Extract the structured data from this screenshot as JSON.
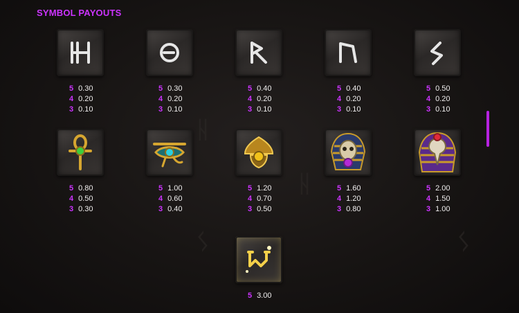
{
  "title": "SYMBOL PAYOUTS",
  "accent_color": "#cc33ff",
  "symbols": [
    {
      "icon": "rune-h-icon",
      "pays": [
        {
          "n": "5",
          "v": "0.30"
        },
        {
          "n": "4",
          "v": "0.20"
        },
        {
          "n": "3",
          "v": "0.10"
        }
      ]
    },
    {
      "icon": "rune-circle-icon",
      "pays": [
        {
          "n": "5",
          "v": "0.30"
        },
        {
          "n": "4",
          "v": "0.20"
        },
        {
          "n": "3",
          "v": "0.10"
        }
      ]
    },
    {
      "icon": "rune-r-icon",
      "pays": [
        {
          "n": "5",
          "v": "0.40"
        },
        {
          "n": "4",
          "v": "0.20"
        },
        {
          "n": "3",
          "v": "0.10"
        }
      ]
    },
    {
      "icon": "rune-u-icon",
      "pays": [
        {
          "n": "5",
          "v": "0.40"
        },
        {
          "n": "4",
          "v": "0.20"
        },
        {
          "n": "3",
          "v": "0.10"
        }
      ]
    },
    {
      "icon": "rune-s-icon",
      "pays": [
        {
          "n": "5",
          "v": "0.50"
        },
        {
          "n": "4",
          "v": "0.20"
        },
        {
          "n": "3",
          "v": "0.10"
        }
      ]
    },
    {
      "icon": "ankh-icon",
      "pays": [
        {
          "n": "5",
          "v": "0.80"
        },
        {
          "n": "4",
          "v": "0.50"
        },
        {
          "n": "3",
          "v": "0.30"
        }
      ]
    },
    {
      "icon": "eye-of-horus-icon",
      "pays": [
        {
          "n": "5",
          "v": "1.00"
        },
        {
          "n": "4",
          "v": "0.60"
        },
        {
          "n": "3",
          "v": "0.40"
        }
      ]
    },
    {
      "icon": "scarab-amulet-icon",
      "pays": [
        {
          "n": "5",
          "v": "1.20"
        },
        {
          "n": "4",
          "v": "0.70"
        },
        {
          "n": "3",
          "v": "0.50"
        }
      ]
    },
    {
      "icon": "pharaoh-skull-icon",
      "pays": [
        {
          "n": "5",
          "v": "1.60"
        },
        {
          "n": "4",
          "v": "1.20"
        },
        {
          "n": "3",
          "v": "0.80"
        }
      ]
    },
    {
      "icon": "bird-skull-icon",
      "pays": [
        {
          "n": "5",
          "v": "2.00"
        },
        {
          "n": "4",
          "v": "1.50"
        },
        {
          "n": "3",
          "v": "1.00"
        }
      ]
    },
    {
      "icon": "wild-icon",
      "pays": [
        {
          "n": "5",
          "v": "3.00"
        }
      ]
    }
  ]
}
